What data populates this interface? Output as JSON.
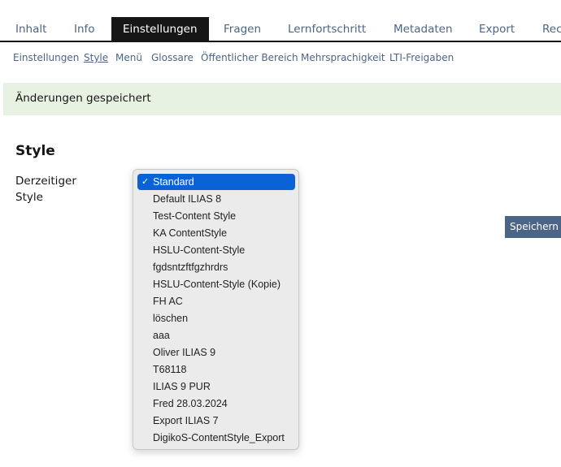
{
  "tabs": [
    {
      "label": "Inhalt",
      "active": false
    },
    {
      "label": "Info",
      "active": false
    },
    {
      "label": "Einstellungen",
      "active": true
    },
    {
      "label": "Fragen",
      "active": false
    },
    {
      "label": "Lernfortschritt",
      "active": false
    },
    {
      "label": "Metadaten",
      "active": false
    },
    {
      "label": "Export",
      "active": false
    },
    {
      "label": "Rec",
      "active": false
    }
  ],
  "subtabs": [
    {
      "label": "Einstellungen",
      "active": false
    },
    {
      "label": "Style",
      "active": true
    },
    {
      "label": "Menü",
      "active": false
    },
    {
      "label": "Glossare",
      "active": false
    },
    {
      "label": "Öffentlicher Bereich",
      "active": false
    },
    {
      "label": "Mehrsprachigkeit",
      "active": false
    },
    {
      "label": "LTI-Freigaben",
      "active": false
    }
  ],
  "message": "Änderungen gespeichert",
  "section_title": "Style",
  "field_label": "Derzeitiger Style",
  "save_label": "Speichern",
  "check_icon": "✓",
  "dropdown": {
    "selected": "Standard",
    "options": [
      "Standard",
      "Default ILIAS 8",
      "Test-Content Style",
      "KA ContentStyle",
      "HSLU-Content-Style",
      "fgdsntzftfgzhrdrs",
      "HSLU-Content-Style (Kopie)",
      "FH AC",
      "löschen",
      "aaa",
      "Oliver ILIAS 9",
      "T68118",
      "ILIAS 9 PUR",
      "Fred 28.03.2024",
      "Export ILIAS 7",
      "DigikoS-ContentStyle_Export"
    ]
  }
}
